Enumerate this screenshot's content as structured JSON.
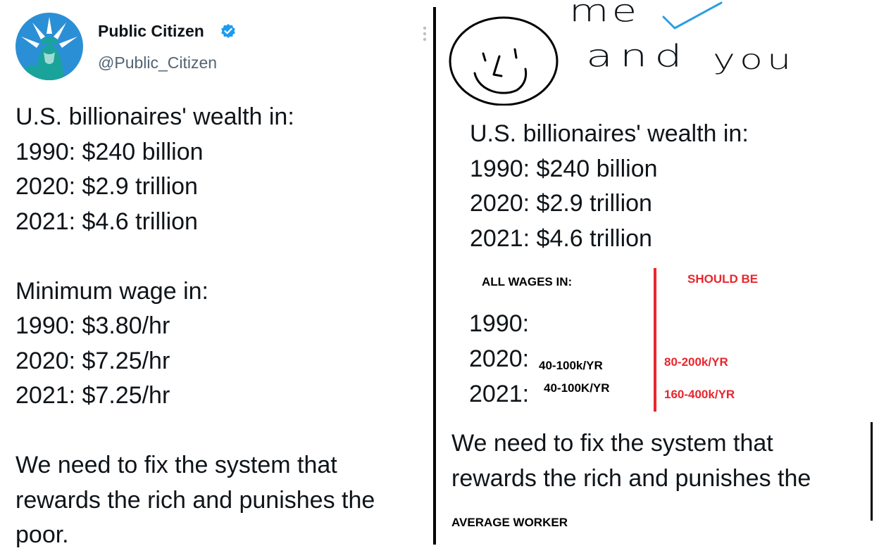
{
  "tweet": {
    "author_name": "Public Citizen",
    "handle": "@Public_Citizen",
    "verified_icon": "verified-badge-icon",
    "more_icon": "vertical-ellipsis-icon",
    "avatar_icon": "statue-of-liberty-logo",
    "brand_color": "#1d9bf0",
    "avatar_color": "#1aa39a",
    "lines": [
      "U.S. billionaires' wealth in:",
      "1990: $240 billion",
      "2020: $2.9 trillion",
      "2021: $4.6 trillion",
      "",
      "Minimum wage in:",
      "1990: $3.80/hr",
      "2020: $7.25/hr",
      "2021: $7.25/hr"
    ],
    "closing_lines": [
      "We need to fix the system that",
      "rewards the rich and punishes the",
      "poor."
    ]
  },
  "meme": {
    "handwriting": {
      "line1": "me",
      "line2": "and",
      "line3": "you",
      "check_icon": "checkmark-icon",
      "check_color": "#2d9ee0"
    },
    "smiley_icon": "smiley-face-drawing",
    "wealth_lines": [
      "U.S. billionaires' wealth in:",
      "1990: $240 billion",
      "2020: $2.9 trillion",
      "2021: $4.6 trillion"
    ],
    "all_wages_label": "ALL WAGES IN:",
    "should_be_label": "SHOULD BE",
    "accent_color": "#e8262d",
    "years": [
      "1990:",
      "2020:",
      "2021:"
    ],
    "current_wages": [
      "40-100k/YR",
      "40-100K/YR"
    ],
    "should_be_wages": [
      "80-200k/YR",
      "160-400k/YR"
    ],
    "closing_lines": [
      "We need to fix the system that",
      "rewards the rich and punishes the"
    ],
    "average_worker_label": "AVERAGE WORKER"
  }
}
